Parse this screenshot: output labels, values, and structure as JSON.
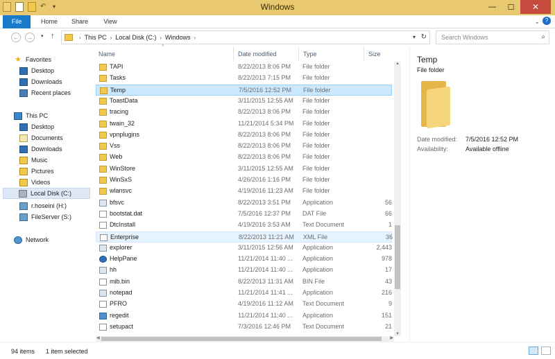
{
  "window": {
    "title": "Windows"
  },
  "ribbon": {
    "tabs": [
      "File",
      "Home",
      "Share",
      "View"
    ]
  },
  "address": {
    "crumbs": [
      "This PC",
      "Local Disk (C:)",
      "Windows"
    ],
    "search_placeholder": "Search Windows"
  },
  "columns": {
    "name": "Name",
    "date": "Date modified",
    "type": "Type",
    "size": "Size"
  },
  "navpane": {
    "favorites": "Favorites",
    "fav_items": [
      "Desktop",
      "Downloads",
      "Recent places"
    ],
    "thispc": "This PC",
    "pc_items": [
      "Desktop",
      "Documents",
      "Downloads",
      "Music",
      "Pictures",
      "Videos",
      "Local Disk (C:)",
      "r.hoseini (H:)",
      "FileServer (S:)"
    ],
    "network": "Network"
  },
  "files": [
    {
      "name": "TAPI",
      "date": "8/22/2013 8:06 PM",
      "type": "File folder",
      "size": "",
      "icon": "folder-icon"
    },
    {
      "name": "Tasks",
      "date": "8/22/2013 7:15 PM",
      "type": "File folder",
      "size": "",
      "icon": "folder-icon"
    },
    {
      "name": "Temp",
      "date": "7/5/2016 12:52 PM",
      "type": "File folder",
      "size": "",
      "icon": "folder-icon"
    },
    {
      "name": "ToastData",
      "date": "3/11/2015 12:55 AM",
      "type": "File folder",
      "size": "",
      "icon": "folder-icon"
    },
    {
      "name": "tracing",
      "date": "8/22/2013 8:06 PM",
      "type": "File folder",
      "size": "",
      "icon": "folder-icon"
    },
    {
      "name": "twain_32",
      "date": "11/21/2014 5:34 PM",
      "type": "File folder",
      "size": "",
      "icon": "folder-icon"
    },
    {
      "name": "vpnplugins",
      "date": "8/22/2013 8:06 PM",
      "type": "File folder",
      "size": "",
      "icon": "folder-icon"
    },
    {
      "name": "Vss",
      "date": "8/22/2013 8:06 PM",
      "type": "File folder",
      "size": "",
      "icon": "folder-icon"
    },
    {
      "name": "Web",
      "date": "8/22/2013 8:06 PM",
      "type": "File folder",
      "size": "",
      "icon": "folder-icon"
    },
    {
      "name": "WinStore",
      "date": "3/11/2015 12:55 AM",
      "type": "File folder",
      "size": "",
      "icon": "folder-icon"
    },
    {
      "name": "WinSxS",
      "date": "4/26/2016 1:16 PM",
      "type": "File folder",
      "size": "",
      "icon": "folder-icon"
    },
    {
      "name": "wlansvc",
      "date": "4/19/2016 11:23 AM",
      "type": "File folder",
      "size": "",
      "icon": "folder-icon"
    },
    {
      "name": "bfsvc",
      "date": "8/22/2013 3:51 PM",
      "type": "Application",
      "size": "56",
      "icon": "exe-icon"
    },
    {
      "name": "bootstat.dat",
      "date": "7/5/2016 12:37 PM",
      "type": "DAT File",
      "size": "66",
      "icon": "document-icon"
    },
    {
      "name": "DtcInstall",
      "date": "4/19/2016 3:53 AM",
      "type": "Text Document",
      "size": "1",
      "icon": "document-icon"
    },
    {
      "name": "Enterprise",
      "date": "8/22/2013 11:21 AM",
      "type": "XML File",
      "size": "36",
      "icon": "xml-icon"
    },
    {
      "name": "explorer",
      "date": "3/11/2015 12:56 AM",
      "type": "Application",
      "size": "2,443",
      "icon": "exe-icon"
    },
    {
      "name": "HelpPane",
      "date": "11/21/2014 11:40 ...",
      "type": "Application",
      "size": "978",
      "icon": "help-icon"
    },
    {
      "name": "hh",
      "date": "11/21/2014 11:40 ...",
      "type": "Application",
      "size": "17",
      "icon": "exe-icon"
    },
    {
      "name": "mib.bin",
      "date": "8/22/2013 11:31 AM",
      "type": "BIN File",
      "size": "43",
      "icon": "document-icon"
    },
    {
      "name": "notepad",
      "date": "11/21/2014 11:41 ...",
      "type": "Application",
      "size": "216",
      "icon": "exe-icon"
    },
    {
      "name": "PFRO",
      "date": "4/19/2016 11:12 AM",
      "type": "Text Document",
      "size": "9",
      "icon": "document-icon"
    },
    {
      "name": "regedit",
      "date": "11/21/2014 11:40 ...",
      "type": "Application",
      "size": "151",
      "icon": "registry-icon"
    },
    {
      "name": "setupact",
      "date": "7/3/2016 12:46 PM",
      "type": "Text Document",
      "size": "21",
      "icon": "document-icon"
    }
  ],
  "selected_index": 2,
  "hover_index": 15,
  "preview": {
    "name": "Temp",
    "type": "File folder",
    "date_label": "Date modified:",
    "date_value": "7/5/2016 12:52 PM",
    "avail_label": "Availability:",
    "avail_value": "Available offline"
  },
  "status": {
    "count": "94 items",
    "selection": "1 item selected"
  },
  "colors": {
    "accent": "#1979ca",
    "titlebar": "#e8c970",
    "selection": "#cce8ff"
  }
}
